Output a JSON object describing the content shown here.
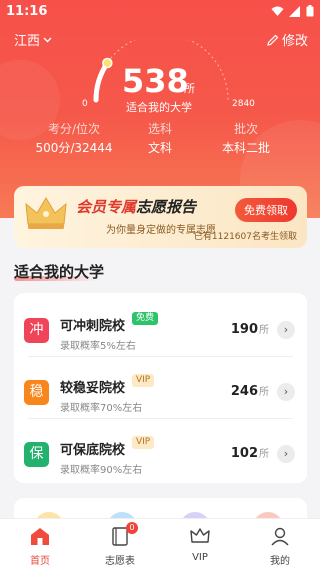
{
  "status_bar": {
    "time": "11:16"
  },
  "header": {
    "region": "江西",
    "edit_label": "修改"
  },
  "gauge": {
    "count": "538",
    "unit": "所",
    "subtitle": "适合我的大学",
    "min_label": "0",
    "max_label": "2840",
    "value": 538,
    "max": 2840
  },
  "stats": [
    {
      "label": "考分/位次",
      "value": "500分/32444"
    },
    {
      "label": "选科",
      "value": "文科"
    },
    {
      "label": "批次",
      "value": "本科二批"
    }
  ],
  "vip_banner": {
    "title_red": "会员专属",
    "title_black": "志愿报告",
    "subtitle": "为你量身定做的专属志愿",
    "button": "免费领取",
    "claim_text": "已有1121607名考生领取"
  },
  "section": {
    "title": "适合我的大学"
  },
  "schools": [
    {
      "icon_char": "冲",
      "icon_color": "#f0445a",
      "name": "可冲刺院校",
      "tag": "免费",
      "tag_style": "free",
      "desc": "录取概率5%左右",
      "count": "190",
      "unit": "所"
    },
    {
      "icon_char": "稳",
      "icon_color": "#f7861d",
      "name": "较稳妥院校",
      "tag": "VIP",
      "tag_style": "vip",
      "desc": "录取概率70%左右",
      "count": "246",
      "unit": "所"
    },
    {
      "icon_char": "保",
      "icon_color": "#23b26d",
      "name": "可保底院校",
      "tag": "VIP",
      "tag_style": "vip",
      "desc": "录取概率90%左右",
      "count": "102",
      "unit": "所"
    }
  ],
  "colors": {
    "accent": "#e84a3a",
    "hero": "#f5594a",
    "free_tag": "#2dc36a",
    "vip_tag_bg": "#fde9c5",
    "vip_tag_text": "#b27723"
  },
  "tabbar": {
    "items": [
      {
        "label": "首页",
        "icon": "home-icon",
        "active": true
      },
      {
        "label": "志愿表",
        "icon": "book-icon",
        "badge": "0"
      },
      {
        "label": "VIP",
        "icon": "crown-icon"
      },
      {
        "label": "我的",
        "icon": "user-icon"
      }
    ]
  }
}
